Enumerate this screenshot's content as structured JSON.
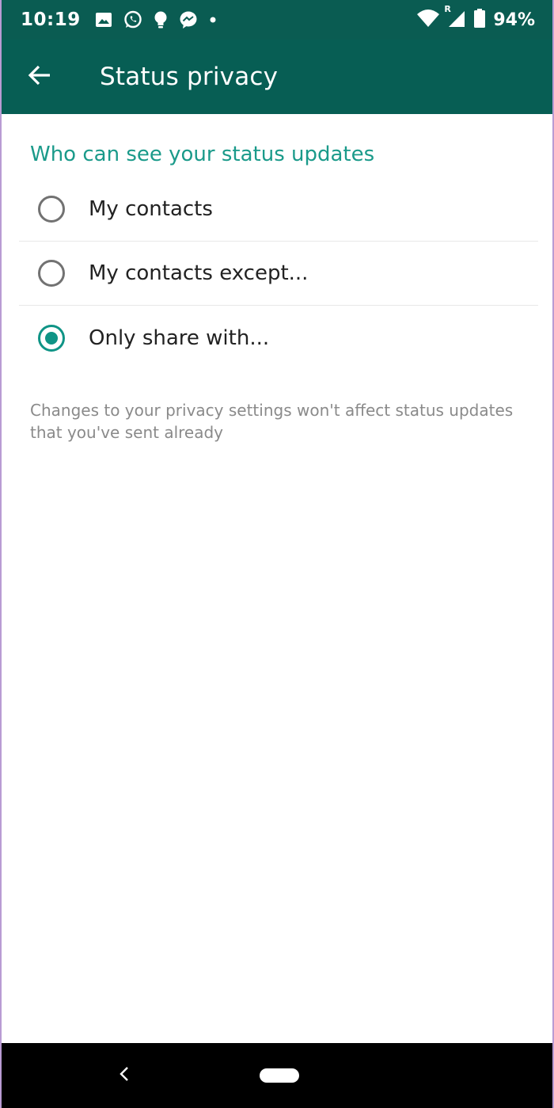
{
  "status_bar": {
    "time": "10:19",
    "battery": "94%",
    "roaming_indicator": "R",
    "notification_icons": [
      "image-icon",
      "whatsapp-icon",
      "lightbulb-icon",
      "messenger-icon",
      "dot-icon"
    ],
    "system_icons": [
      "wifi-icon",
      "signal-icon",
      "battery-icon"
    ]
  },
  "app_bar": {
    "title": "Status privacy",
    "back_icon": "arrow-left-icon",
    "background": "#075e54"
  },
  "section": {
    "header": "Who can see your status updates",
    "options": [
      {
        "label": "My contacts",
        "selected": false
      },
      {
        "label": "My contacts except...",
        "selected": false
      },
      {
        "label": "Only share with...",
        "selected": true
      }
    ],
    "footnote": "Changes to your privacy settings won't affect status updates that you've sent already"
  },
  "colors": {
    "accent": "#0f9486",
    "header_text": "#1a9a8a",
    "status_bar": "#0a5c52"
  },
  "nav_bar": {
    "buttons": [
      "back-icon",
      "home-pill"
    ]
  }
}
